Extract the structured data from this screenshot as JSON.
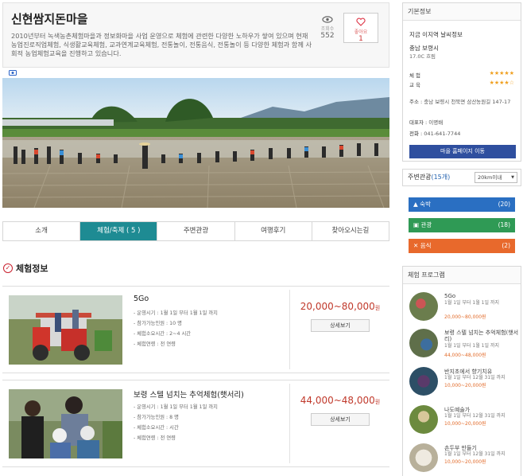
{
  "header": {
    "title": "신현쌈지돈마을",
    "description": "2010년부터 녹색농촌체험마을과 정보화마을 사업 운영으로 체험에 관련한 다양한 노하우가 쌓여 있으며 현재 농업진로직업체험, 식생활교육체험, 교과연계교육체험, 전통놀이, 전통음식, 전통놀이 등 다양한 체험과 함께 사회적 농업체험교육을 진행하고 있습니다.",
    "views_label": "조회수",
    "views": "552",
    "like_label": "좋아요",
    "likes": "1"
  },
  "tabs": [
    "소개",
    "체험/축제 ( 5 )",
    "주변관광",
    "여행후기",
    "찾아오시는길"
  ],
  "section_title": "체험정보",
  "programs": [
    {
      "name": "5Go",
      "lines": [
        "- 운영시기 : 1월 1일 부터 1월 1일 까지",
        "- 참가가능인원 : 10 명",
        "- 체험소요시간 : 2~4 시간",
        "- 체험연령 : 전 연령"
      ],
      "price": "20,000~80,000",
      "unit": "원",
      "button": "상세보기"
    },
    {
      "name": "보령 스텔 넘치는 추억체험(햇서리)",
      "lines": [
        "- 운영시기 : 1월 1일 부터 1월 1일 까지",
        "- 참가가능인원 : 8 명",
        "- 체험소요시간 : 시간",
        "- 체험연령 : 전 연령"
      ],
      "price": "44,000~48,000",
      "unit": "원",
      "button": "상세보기"
    }
  ],
  "side": {
    "basic_title": "기본정보",
    "weather_line1": "지금 이지역 날씨정보",
    "weather_line2": "충남 보령시",
    "weather_line3": "17.0C 흐림",
    "rating_experience_label": "체 험",
    "rating_experience_stars": "★★★★★",
    "rating_education_label": "교 육",
    "rating_education_stars": "★★★★☆",
    "address_label": "주소 :",
    "address": "충남 보령시 천북면 삼산농원길 147-17",
    "rep_label": "대표자 :",
    "rep": "이명배",
    "phone_label": "전화 :",
    "phone": "041-641-7744",
    "home_button": "마을 홈페이지 이동",
    "near_title": "주변관광",
    "near_count": "(15개)",
    "near_select": "20km이내",
    "categories": [
      {
        "label": "숙박",
        "count": "(20)",
        "color": "#2a6fc2"
      },
      {
        "label": "관광",
        "count": "(18)",
        "color": "#2f9a55"
      },
      {
        "label": "음식",
        "count": "(2)",
        "color": "#e8692c"
      }
    ],
    "prog_title": "체험 프로그램",
    "prog_items": [
      {
        "name": "5Go",
        "date": "1월 1일 부터 1월 1일 까지",
        "price": "20,000~80,000원"
      },
      {
        "name": "보령 스텔 넘치는 추억체험(햇서리)",
        "date": "1월 1일 부터 1월 1일 까지",
        "price": "44,000~48,000원"
      },
      {
        "name": "반지초에서 향기치유",
        "date": "1월 1일 부터 12월 31일 까지",
        "price": "10,000~20,000원"
      },
      {
        "name": "나도예술가",
        "date": "1월 1일 부터 12월 31일 까지",
        "price": "10,000~20,000원"
      },
      {
        "name": "손두부 만들기",
        "date": "1월 1일 부터 12월 31일 까지",
        "price": "10,000~20,000원"
      }
    ]
  },
  "colors": {
    "accent_tab": "#1e8b93",
    "price": "#c0392b",
    "home_button": "#2f4f9f"
  }
}
